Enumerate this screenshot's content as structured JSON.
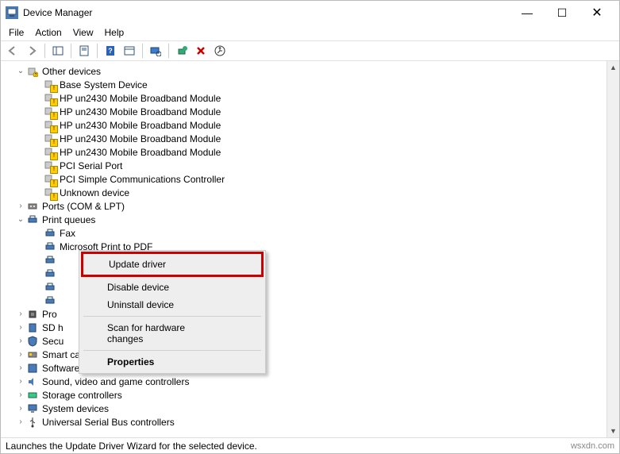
{
  "window_title": "Device Manager",
  "menu": {
    "file": "File",
    "action": "Action",
    "view": "View",
    "help": "Help"
  },
  "tree": {
    "other_devices": {
      "label": "Other devices",
      "children": [
        {
          "label": "Base System Device"
        },
        {
          "label": "HP un2430 Mobile Broadband Module"
        },
        {
          "label": "HP un2430 Mobile Broadband Module"
        },
        {
          "label": "HP un2430 Mobile Broadband Module"
        },
        {
          "label": "HP un2430 Mobile Broadband Module"
        },
        {
          "label": "HP un2430 Mobile Broadband Module"
        },
        {
          "label": "PCI Serial Port"
        },
        {
          "label": "PCI Simple Communications Controller"
        },
        {
          "label": "Unknown device"
        }
      ]
    },
    "ports": {
      "label": "Ports (COM & LPT)"
    },
    "print_queues": {
      "label": "Print queues",
      "children": [
        {
          "label": "Fax"
        },
        {
          "label": "Microsoft Print to PDF"
        },
        {
          "label": ""
        },
        {
          "label": ""
        },
        {
          "label": ""
        },
        {
          "label": ""
        }
      ]
    },
    "processors": {
      "label": "Pro"
    },
    "sd_host": {
      "label": "SD h"
    },
    "security": {
      "label": "Secu"
    },
    "smart_card": {
      "label": "Smart card readers"
    },
    "software": {
      "label": "Software devices"
    },
    "sound": {
      "label": "Sound, video and game controllers"
    },
    "storage": {
      "label": "Storage controllers"
    },
    "system": {
      "label": "System devices"
    },
    "usb": {
      "label": "Universal Serial Bus controllers"
    }
  },
  "context_menu": {
    "update": "Update driver",
    "disable": "Disable device",
    "uninstall": "Uninstall device",
    "scan": "Scan for hardware changes",
    "properties": "Properties"
  },
  "statusbar": {
    "text": "Launches the Update Driver Wizard for the selected device.",
    "watermark": "wsxdn.com"
  }
}
